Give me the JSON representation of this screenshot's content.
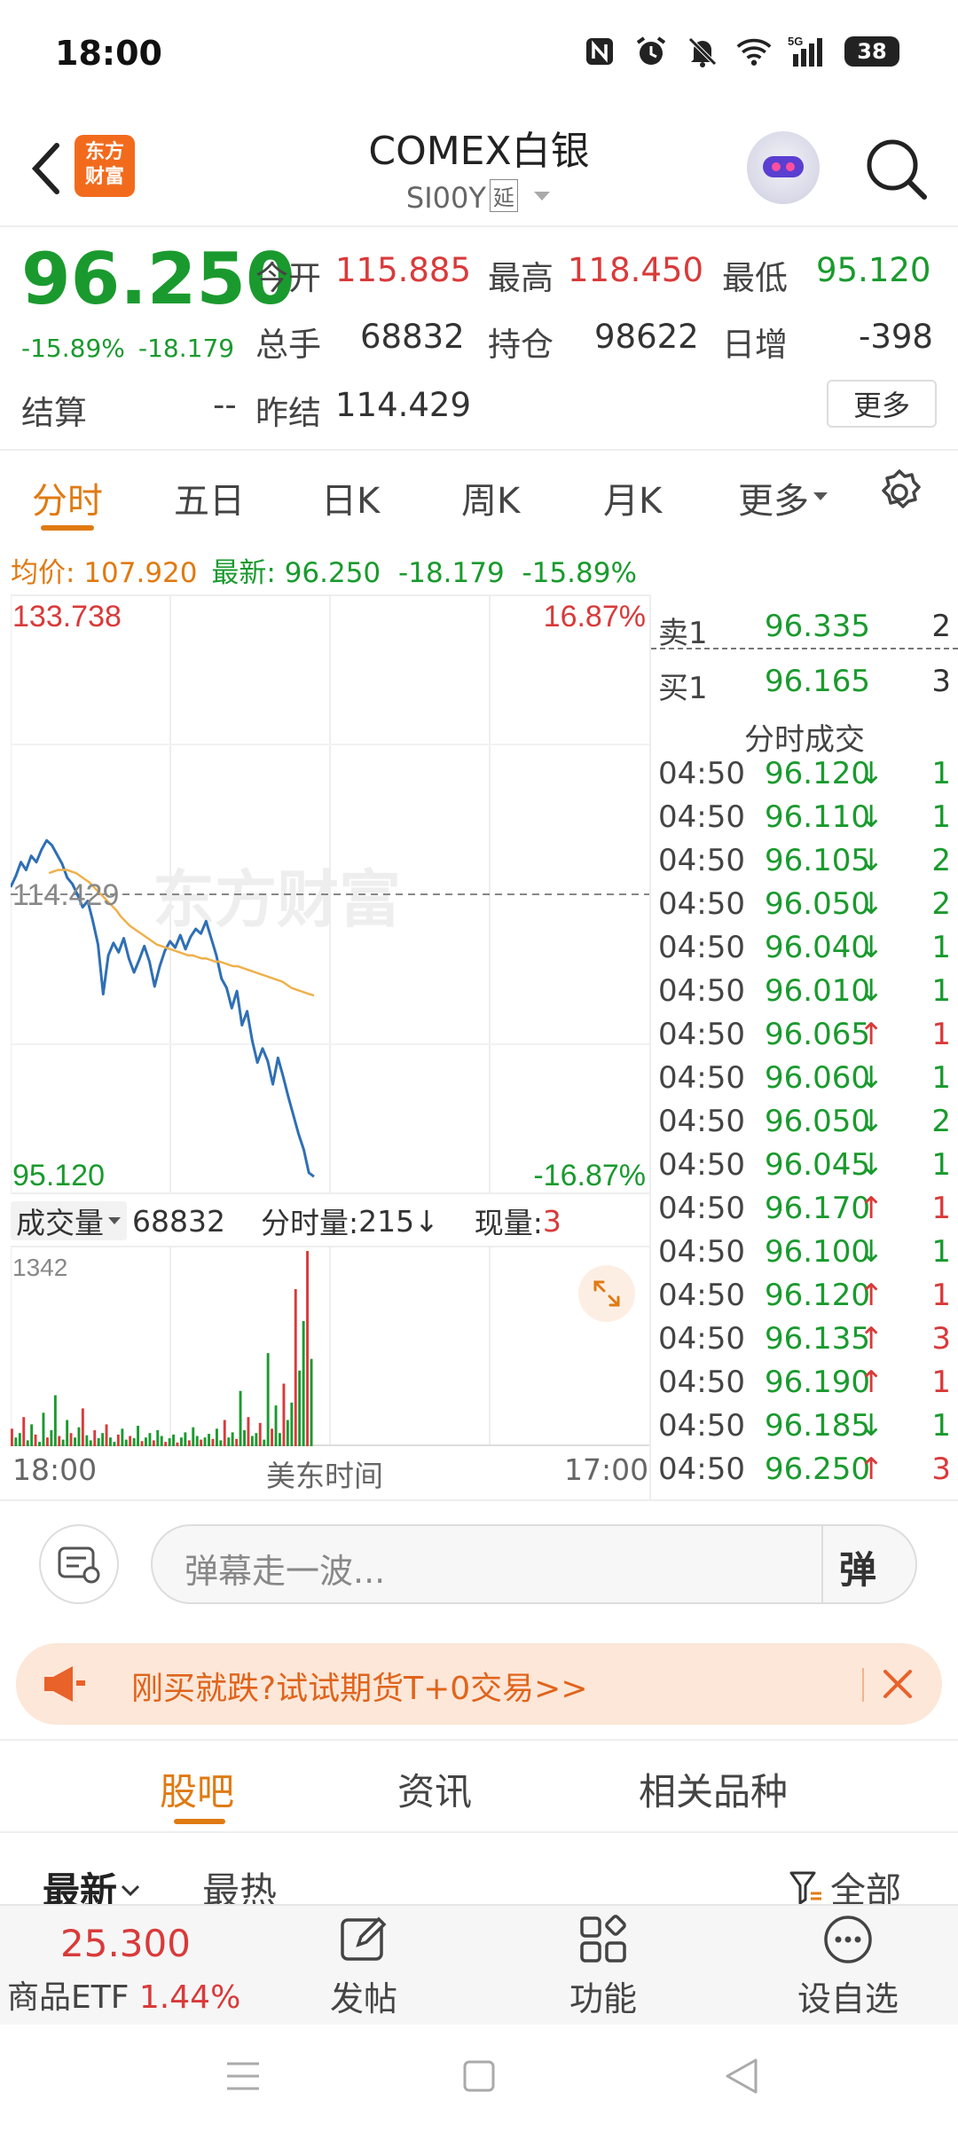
{
  "status_bar": {
    "time": "18:00",
    "battery": "38",
    "signal_label": "5G"
  },
  "header": {
    "logo_text_1": "东方",
    "logo_text_2": "财富",
    "title": "COMEX白银",
    "code": "SI00Y",
    "delay_tag": "延"
  },
  "quote": {
    "price": "96.250",
    "change_pct": "-15.89%",
    "change_amt": "-18.179",
    "open_label": "今开",
    "open": "115.885",
    "high_label": "最高",
    "high": "118.450",
    "low_label": "最低",
    "low": "95.120",
    "volume_label": "总手",
    "volume": "68832",
    "oi_label": "持仓",
    "oi": "98622",
    "daily_inc_label": "日增",
    "daily_inc": "-398",
    "settle_label": "结算",
    "settle": "--",
    "prev_settle_label": "昨结",
    "prev_settle": "114.429",
    "more": "更多"
  },
  "tabs": [
    "分时",
    "五日",
    "日K",
    "周K",
    "月K",
    "更多"
  ],
  "avg_line": {
    "avg_label": "均价:",
    "avg": "107.920",
    "latest_label": "最新:",
    "latest": "96.250",
    "chg": "-18.179",
    "pct": "-15.89%"
  },
  "chart_data": {
    "type": "line",
    "title": "",
    "y_top_label": "133.738",
    "y_top_pct": "16.87%",
    "y_mid_label": "114.429",
    "y_bottom_label": "95.120",
    "y_bottom_pct": "-16.87%",
    "ylim": [
      95.12,
      133.738
    ],
    "prev_settle": 114.429,
    "watermark": "东方财富",
    "x_start": "18:00",
    "x_mid": "美东时间",
    "x_end": "17:00",
    "series": [
      {
        "name": "",
        "color": "#2f6fb5",
        "values": [
          114.9,
          115.6,
          116.5,
          116.0,
          116.9,
          116.5,
          117.3,
          117.9,
          117.6,
          117.0,
          116.4,
          115.5,
          115.1,
          114.4,
          113.6,
          114.0,
          112.7,
          111.2,
          108.0,
          110.5,
          111.3,
          110.7,
          111.6,
          110.3,
          109.4,
          110.2,
          111.1,
          110.1,
          108.5,
          109.8,
          110.8,
          111.4,
          111.0,
          111.8,
          110.9,
          111.7,
          112.2,
          111.9,
          112.7,
          111.6,
          110.5,
          109.0,
          108.4,
          107.1,
          108.2,
          106.0,
          106.9,
          105.0,
          103.6,
          104.5,
          103.7,
          102.2,
          103.9,
          102.7,
          101.4,
          100.2,
          99.0,
          98.0,
          96.5,
          96.25
        ]
      },
      {
        "name": "",
        "color": "#efb04a",
        "values": [
          115.8,
          115.9,
          116.0,
          116.0,
          116.0,
          115.9,
          115.8,
          115.6,
          115.4,
          115.2,
          114.9,
          114.6,
          114.3,
          114.0,
          113.7,
          113.4,
          113.0,
          112.7,
          112.4,
          112.2,
          112.0,
          111.8,
          111.6,
          111.4,
          111.2,
          111.1,
          111.0,
          110.9,
          110.8,
          110.7,
          110.6,
          110.5,
          110.5,
          110.4,
          110.3,
          110.3,
          110.2,
          110.1,
          110.1,
          110.0,
          109.9,
          109.8,
          109.8,
          109.7,
          109.6,
          109.5,
          109.4,
          109.3,
          109.2,
          109.1,
          109.0,
          108.9,
          108.8,
          108.6,
          108.4,
          108.3,
          108.2,
          108.1,
          108.0,
          107.92
        ]
      }
    ],
    "volume": {
      "label": "成交量",
      "total": "68832",
      "fenshi_label": "分时量:",
      "fenshi": "215↓",
      "current_label": "现量:",
      "current": "3",
      "ymax_label": "1342",
      "ymax": 1342,
      "bars": [
        120,
        60,
        90,
        200,
        40,
        150,
        80,
        30,
        230,
        60,
        110,
        350,
        70,
        45,
        180,
        90,
        60,
        130,
        260,
        75,
        40,
        110,
        55,
        90,
        150,
        60,
        30,
        80,
        120,
        45,
        70,
        55,
        140,
        35,
        60,
        90,
        40,
        110,
        70,
        30,
        55,
        80,
        25,
        60,
        95,
        40,
        130,
        70,
        45,
        60,
        85,
        50,
        120,
        40,
        180,
        60,
        95,
        50,
        380,
        110,
        200,
        70,
        90,
        160,
        45,
        640,
        120,
        280,
        90,
        430,
        180,
        300,
        1080,
        520,
        860,
        1342,
        600
      ]
    }
  },
  "order_book": {
    "sell1_label": "卖1",
    "sell1_price": "96.335",
    "sell1_vol": "2",
    "buy1_label": "买1",
    "buy1_price": "96.165",
    "buy1_vol": "3",
    "title": "分时成交",
    "ticks": [
      {
        "time": "04:50",
        "price": "96.120",
        "dir": "↓",
        "vol": "1"
      },
      {
        "time": "04:50",
        "price": "96.110",
        "dir": "↓",
        "vol": "1"
      },
      {
        "time": "04:50",
        "price": "96.105",
        "dir": "↓",
        "vol": "2"
      },
      {
        "time": "04:50",
        "price": "96.050",
        "dir": "↓",
        "vol": "2"
      },
      {
        "time": "04:50",
        "price": "96.040",
        "dir": "↓",
        "vol": "1"
      },
      {
        "time": "04:50",
        "price": "96.010",
        "dir": "↓",
        "vol": "1"
      },
      {
        "time": "04:50",
        "price": "96.065",
        "dir": "↑",
        "vol": "1"
      },
      {
        "time": "04:50",
        "price": "96.060",
        "dir": "↓",
        "vol": "1"
      },
      {
        "time": "04:50",
        "price": "96.050",
        "dir": "↓",
        "vol": "2"
      },
      {
        "time": "04:50",
        "price": "96.045",
        "dir": "↓",
        "vol": "1"
      },
      {
        "time": "04:50",
        "price": "96.170",
        "dir": "↑",
        "vol": "1"
      },
      {
        "time": "04:50",
        "price": "96.100",
        "dir": "↓",
        "vol": "1"
      },
      {
        "time": "04:50",
        "price": "96.120",
        "dir": "↑",
        "vol": "1"
      },
      {
        "time": "04:50",
        "price": "96.135",
        "dir": "↑",
        "vol": "3"
      },
      {
        "time": "04:50",
        "price": "96.190",
        "dir": "↑",
        "vol": "1"
      },
      {
        "time": "04:50",
        "price": "96.185",
        "dir": "↓",
        "vol": "1"
      },
      {
        "time": "04:50",
        "price": "96.250",
        "dir": "↑",
        "vol": "3"
      }
    ]
  },
  "danmu": {
    "placeholder": "弹幕走一波...",
    "send": "弹"
  },
  "promo": {
    "text": "刚买就跌?试试期货T+0交易>>"
  },
  "bottom_tabs": [
    "股吧",
    "资讯",
    "相关品种"
  ],
  "sort": {
    "newest": "最新",
    "hottest": "最热",
    "filter": "全部"
  },
  "bottom_bar": {
    "etf_price": "25.300",
    "etf_name": "商品ETF",
    "etf_pct": "1.44%",
    "post": "发帖",
    "features": "功能",
    "watchlist": "设自选"
  },
  "colors": {
    "up": "#d93a3a",
    "down": "#1a9a2e",
    "accent": "#e07a12",
    "price_line": "#2f6fb5",
    "avg_line": "#efb04a"
  }
}
